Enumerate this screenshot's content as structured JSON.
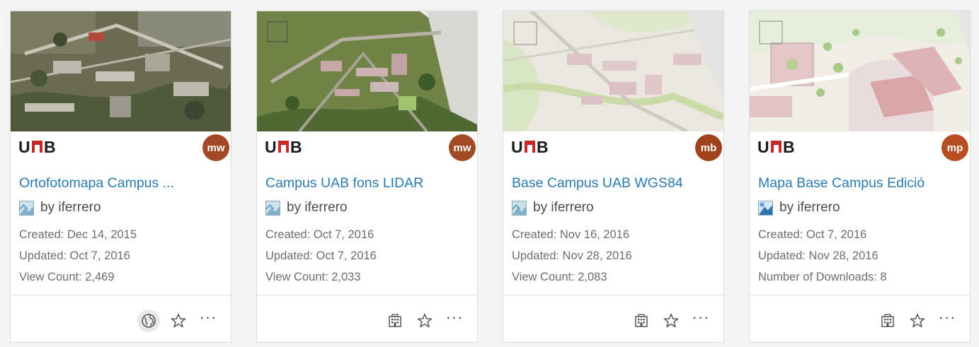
{
  "cards": [
    {
      "title": "Ortofotomapa Campus ...",
      "owner": "by iferrero",
      "created": "Created: Dec 14, 2015",
      "updated": "Updated: Oct 7, 2016",
      "stat": "View Count: 2,469",
      "avatar": "mw",
      "avatar_color": "#a24a25",
      "share_icon": "globe-icon"
    },
    {
      "title": "Campus UAB fons LIDAR",
      "owner": "by iferrero",
      "created": "Created: Oct 7, 2016",
      "updated": "Updated: Oct 7, 2016",
      "stat": "View Count: 2,033",
      "avatar": "mw",
      "avatar_color": "#a24a25",
      "share_icon": "organization-icon"
    },
    {
      "title": "Base Campus UAB WGS84",
      "owner": "by iferrero",
      "created": "Created: Nov 16, 2016",
      "updated": "Updated: Nov 28, 2016",
      "stat": "View Count: 2,083",
      "avatar": "mb",
      "avatar_color": "#a0431c",
      "share_icon": "organization-icon"
    },
    {
      "title": "Mapa Base Campus Edició",
      "owner": "by iferrero",
      "created": "Created: Oct 7, 2016",
      "updated": "Updated: Nov 28, 2016",
      "stat": "Number of Downloads: 8",
      "avatar": "mp",
      "avatar_color": "#b84f22",
      "share_icon": "organization-icon"
    }
  ],
  "icons": {
    "favorite": "star-icon",
    "more": "more-options-icon",
    "logo": "UAB"
  },
  "more_label": "···"
}
